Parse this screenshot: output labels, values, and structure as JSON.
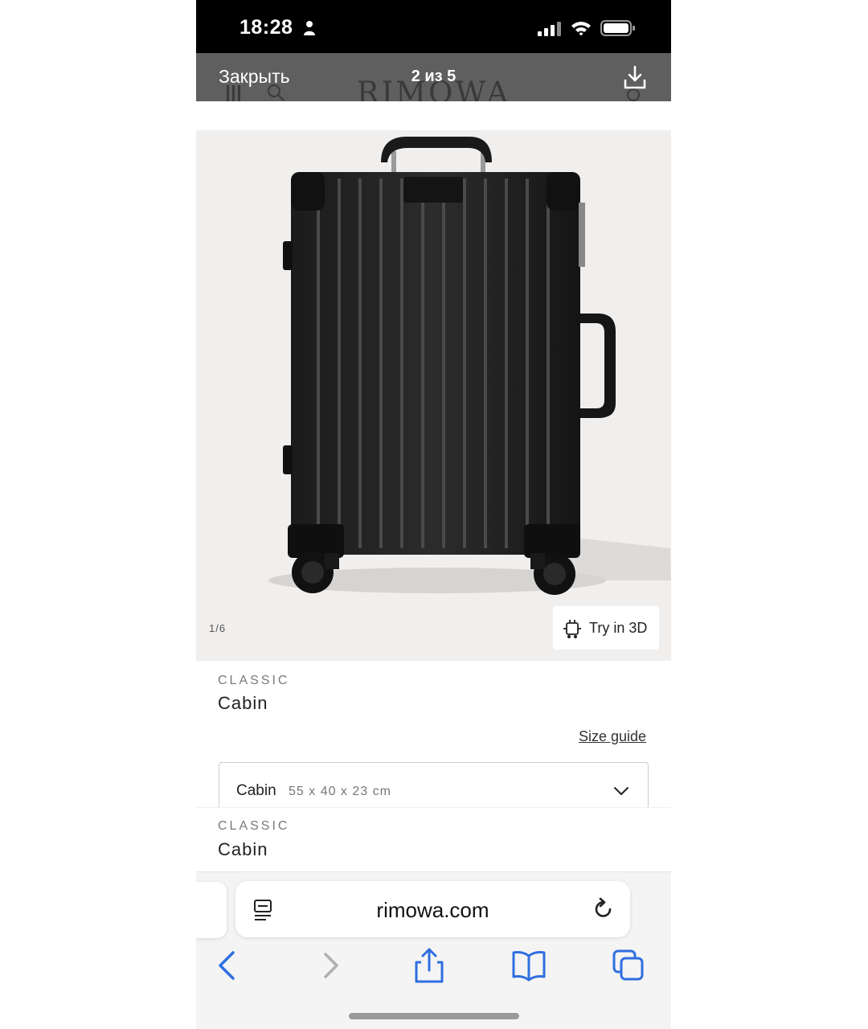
{
  "status_bar": {
    "time": "18:28"
  },
  "viewer": {
    "close_label": "Закрыть",
    "counter": "2 из 5",
    "background_logo": "RIMOWA"
  },
  "product": {
    "image_counter": "1/6",
    "try_3d_label": "Try in 3D",
    "collection": "CLASSIC",
    "name": "Cabin",
    "size_guide_label": "Size guide",
    "size_select": {
      "value": "Cabin",
      "dimensions": "55 x 40 x 23 cm"
    }
  },
  "sticky_header": {
    "collection": "CLASSIC",
    "name": "Cabin"
  },
  "browser": {
    "address": "rimowa.com",
    "accent_color": "#2f6fe0"
  }
}
